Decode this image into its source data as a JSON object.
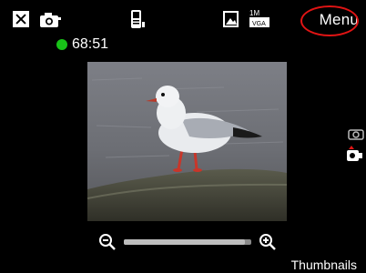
{
  "header": {
    "menu_label": "Menu",
    "icons": [
      "close-icon",
      "camera-icon",
      "phone-icon",
      "gallery-icon",
      "resolution-icon"
    ],
    "resolution_text": "1M VGA"
  },
  "status": {
    "recording_time": "68:51",
    "recording_color": "#18c218"
  },
  "zoom": {
    "level": 0.95,
    "out_icon": "zoom-out-icon",
    "in_icon": "zoom-in-icon"
  },
  "side": {
    "icons": [
      "camera-mode-icon",
      "video-mode-icon"
    ]
  },
  "footer": {
    "thumbnails_label": "Thumbnails"
  },
  "colors": {
    "background": "#000000",
    "highlight": "#e01414"
  }
}
